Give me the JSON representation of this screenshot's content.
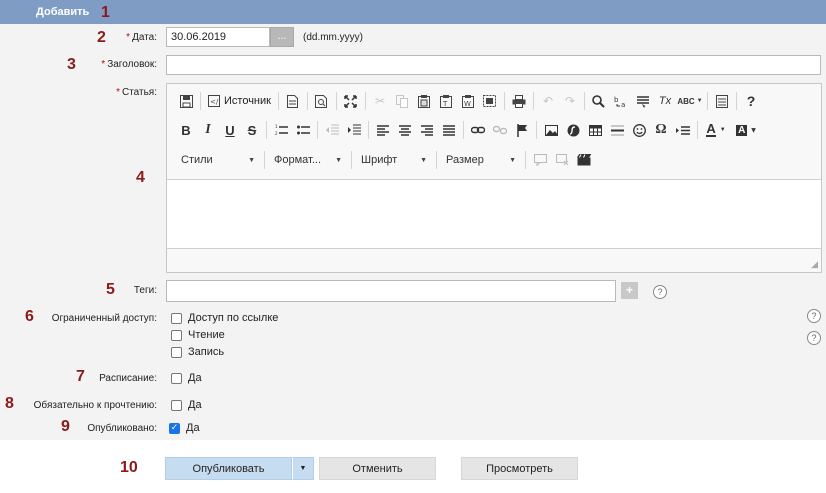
{
  "header": {
    "title": "Добавить"
  },
  "markers": [
    "1",
    "2",
    "3",
    "4",
    "5",
    "6",
    "7",
    "8",
    "9",
    "10"
  ],
  "required_mark": "*",
  "date": {
    "label": "Дата:",
    "value": "30.06.2019",
    "picker_label": "...",
    "hint": "(dd.mm.yyyy)"
  },
  "title_field": {
    "label": "Заголовок:",
    "value": ""
  },
  "article": {
    "label": "Статья:",
    "toolbar": {
      "source_label": "Источник",
      "styles_label": "Стили",
      "format_label": "Формат...",
      "font_label": "Шрифт",
      "size_label": "Размер",
      "bold": "B",
      "italic": "I",
      "underline": "U",
      "strike": "S",
      "text_color": "A",
      "bg_color": "A",
      "help": "?",
      "omega": "Ω",
      "remove_format": "Tx",
      "spell": "ABC"
    },
    "resize_glyph": "◢"
  },
  "tags": {
    "label": "Теги:",
    "value": "",
    "add_label": "+",
    "help": "?"
  },
  "access": {
    "label": "Ограниченный доступ:",
    "options": [
      {
        "label": "Доступ по ссылке",
        "checked": false
      },
      {
        "label": "Чтение",
        "checked": false
      },
      {
        "label": "Запись",
        "checked": false
      }
    ],
    "help": "?"
  },
  "schedule": {
    "label": "Расписание:",
    "option": "Да",
    "checked": false
  },
  "mandatory": {
    "label": "Обязательно к прочтению:",
    "option": "Да",
    "checked": false
  },
  "published": {
    "label": "Опубликовано:",
    "option": "Да",
    "checked": true,
    "check_glyph": "✓"
  },
  "buttons": {
    "publish": "Опубликовать",
    "split_glyph": "▼",
    "cancel": "Отменить",
    "preview": "Просмотреть"
  },
  "colors": {
    "header": "#7f9cc4",
    "marker": "#8b1a1a",
    "required": "#cc0000",
    "primary_button": "#c6dcf1",
    "checkbox_checked": "#1a73e8"
  }
}
